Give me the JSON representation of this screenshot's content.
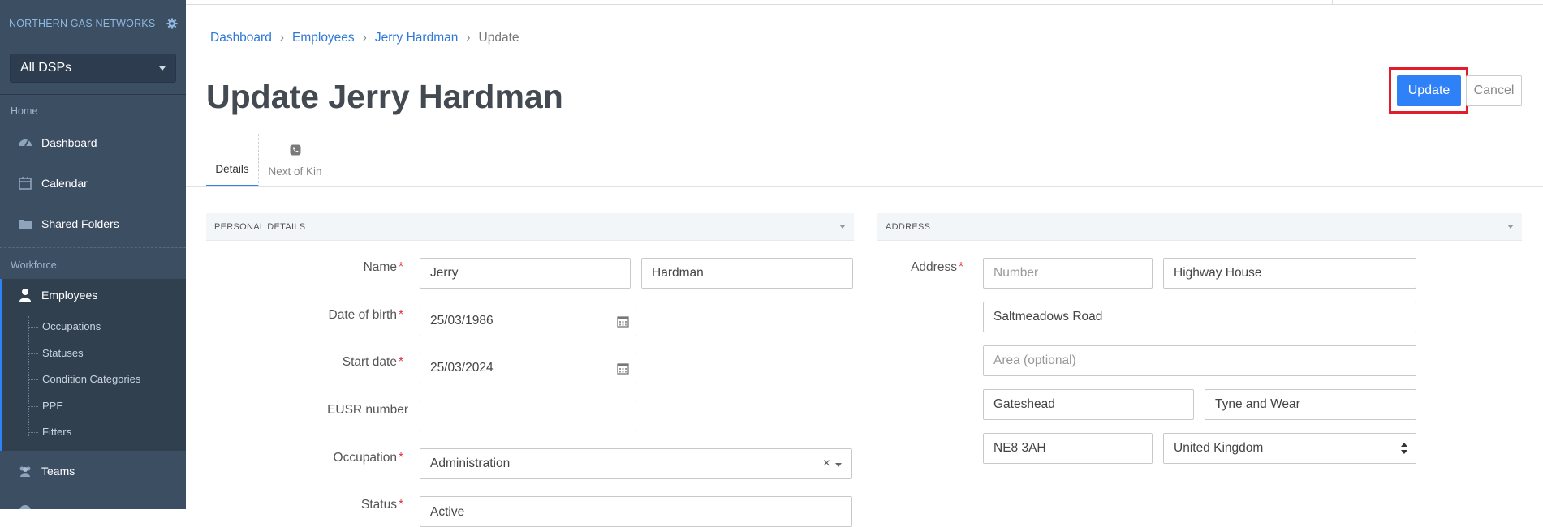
{
  "sidebar": {
    "org_name": "NORTHERN GAS NETWORKS",
    "dsp_select": "All DSPs",
    "sections": {
      "home": "Home",
      "workforce": "Workforce"
    },
    "home_items": [
      {
        "label": "Dashboard"
      },
      {
        "label": "Calendar"
      },
      {
        "label": "Shared Folders"
      }
    ],
    "workforce_items": {
      "employees": "Employees",
      "sub_items": [
        "Occupations",
        "Statuses",
        "Condition Categories",
        "PPE",
        "Fitters"
      ],
      "teams": "Teams"
    }
  },
  "breadcrumb": [
    "Dashboard",
    "Employees",
    "Jerry Hardman",
    "Update"
  ],
  "page_title": "Update Jerry Hardman",
  "actions": {
    "update": "Update",
    "cancel": "Cancel"
  },
  "tabs": {
    "details": "Details",
    "next_of_kin": "Next of Kin"
  },
  "personal": {
    "heading": "PERSONAL DETAILS",
    "name_label": "Name",
    "first_name": "Jerry",
    "last_name": "Hardman",
    "dob_label": "Date of birth",
    "dob": "25/03/1986",
    "start_label": "Start date",
    "start": "25/03/2024",
    "eusr_label": "EUSR number",
    "eusr": "",
    "occupation_label": "Occupation",
    "occupation": "Administration",
    "status_label": "Status",
    "status": "Active"
  },
  "address": {
    "heading": "ADDRESS",
    "label": "Address",
    "number_placeholder": "Number",
    "line1": "Highway House",
    "line2": "Saltmeadows Road",
    "area_placeholder": "Area (optional)",
    "town": "Gateshead",
    "county": "Tyne and Wear",
    "postcode": "NE8 3AH",
    "country": "United Kingdom"
  },
  "colors": {
    "sidebar": "#3b4e62",
    "accent": "#2f81f7",
    "highlight": "#e11d2a",
    "required": "#e0333e"
  }
}
